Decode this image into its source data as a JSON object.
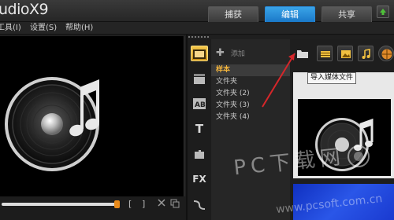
{
  "app": {
    "title": "udioX9"
  },
  "tabs": {
    "capture": "捕获",
    "edit": "编辑",
    "share": "共享"
  },
  "menu": {
    "tools": "工具(I)",
    "settings": "设置(S)",
    "help": "帮助(H)"
  },
  "library": {
    "add_label": "添加",
    "folders": [
      "样本",
      "文件夹",
      "文件夹 (2)",
      "文件夹 (3)",
      "文件夹 (4)"
    ]
  },
  "side_tools": {
    "title": "T",
    "fx": "FX",
    "text": "AB"
  },
  "preview_controls": {
    "mark_in": "[",
    "mark_out": "]"
  },
  "tooltip": {
    "text": "导入媒体文件"
  },
  "watermark": {
    "text": "PC下载网",
    "url": "www.pcsoft.com.cn"
  },
  "colors": {
    "accent": "#1f86d8",
    "selected_folder": "#f2b43c",
    "arrow": "#d6262a"
  }
}
